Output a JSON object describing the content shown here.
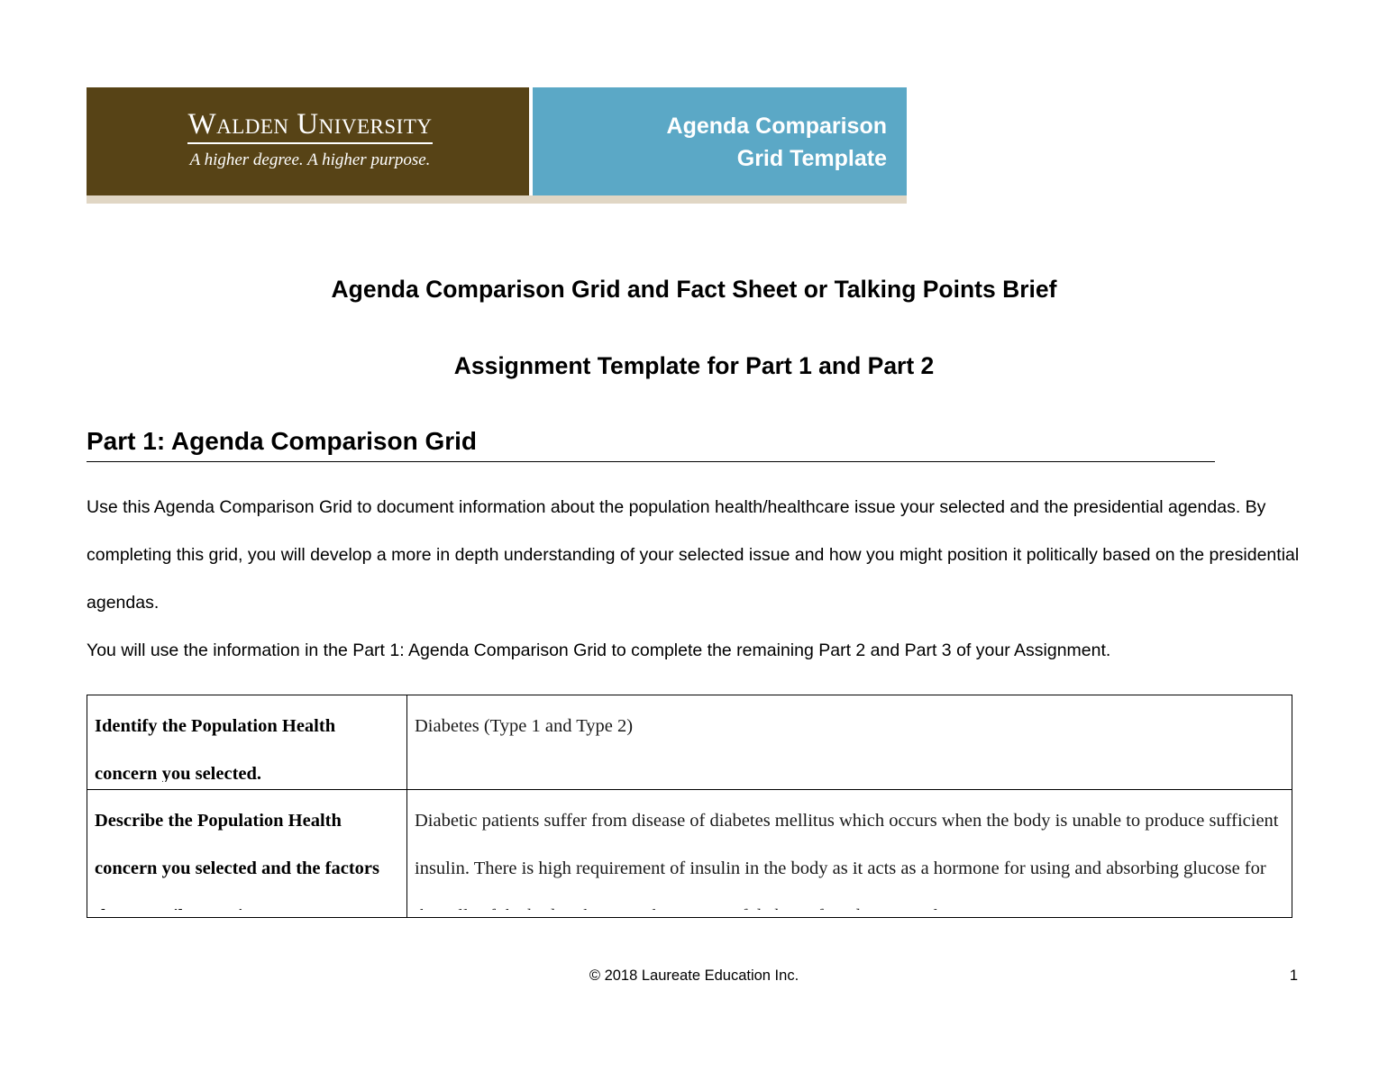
{
  "banner": {
    "logo_name": "Walden University",
    "logo_tagline": "A higher degree. A higher purpose.",
    "title_line_1": "Agenda Comparison",
    "title_line_2": "Grid Template",
    "colors": {
      "brown": "#574316",
      "teal": "#5BA8C6",
      "beige": "#E0D6C4",
      "text": "#FFFFFF"
    }
  },
  "document": {
    "title_line_1": "Agenda Comparison Grid and Fact Sheet or Talking Points Brief",
    "title_line_2": "Assignment Template for Part 1 and Part 2",
    "heading_part_1": "Part 1: Agenda Comparison Grid",
    "paragraph_1": "Use this Agenda Comparison Grid to document information about the population health/healthcare issue your selected and the presidential agendas. By completing this grid, you will develop a more in depth understanding of your selected issue and how you might position it politically based on the presidential agendas.",
    "paragraph_2": "You will use the information in the Part 1: Agenda Comparison Grid to complete the remaining Part 2 and Part 3 of your Assignment."
  },
  "grid": {
    "rows": [
      {
        "label": "Identify the Population Health concern you selected.",
        "value": "Diabetes (Type 1 and Type 2)"
      },
      {
        "label": "Describe the Population Health concern you selected and the factors that contribute to it.",
        "value": "Diabetic patients suffer from disease of diabetes mellitus which occurs when the body is unable to produce sufficient insulin. There is high requirement of insulin in the body as it acts as a hormone for using and absorbing glucose for the cells of the body. There are three types of diabetes found in general"
      }
    ]
  },
  "footer": {
    "copyright": "© 2018 Laureate Education Inc.",
    "page_number": "1"
  }
}
